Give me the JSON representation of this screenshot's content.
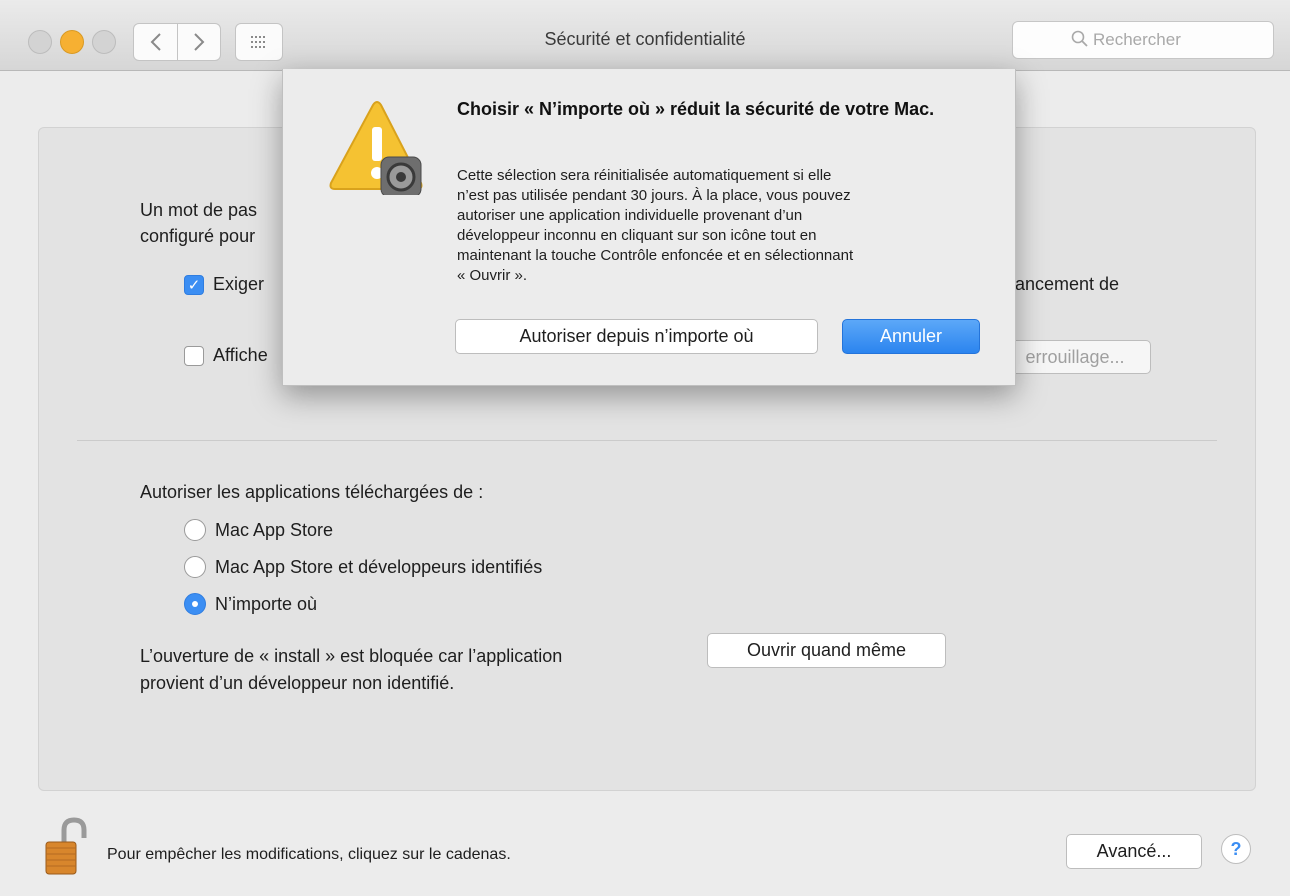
{
  "window": {
    "title": "Sécurité et confidentialité"
  },
  "toolbar": {
    "back_icon": "chevron-left-icon",
    "forward_icon": "chevron-right-icon",
    "grid_icon": "grid-icon",
    "search_placeholder": "Rechercher"
  },
  "general": {
    "password_line1": "Un mot de pas",
    "password_line2": "configuré pour",
    "require_label": "Exiger",
    "require_checked": true,
    "require_suffix": "lancement de",
    "show_label": "Affiche",
    "show_checked": false,
    "set_lock_button": "errouillage..."
  },
  "gatekeeper": {
    "heading": "Autoriser les applications téléchargées de :",
    "options": [
      {
        "label": "Mac App Store",
        "selected": false
      },
      {
        "label": "Mac App Store et développeurs identifiés",
        "selected": false
      },
      {
        "label": "N’importe où",
        "selected": true
      }
    ],
    "blocked_line1": "L’ouverture de « install » est bloquée car l’application",
    "blocked_line2": "provient d’un développeur non identifié.",
    "open_anyway_button": "Ouvrir quand même"
  },
  "footer": {
    "lock_text": "Pour empêcher les modifications, cliquez sur le cadenas.",
    "advanced_button": "Avancé...",
    "help_label": "?"
  },
  "dialog": {
    "title": "Choisir « N’importe où » réduit la sécurité de votre Mac.",
    "body_lines": [
      "Cette sélection sera réinitialisée automatiquement si elle",
      "n’est pas utilisée pendant 30 jours. À la place, vous pouvez",
      "autoriser une application individuelle provenant d’un",
      "développeur inconnu en cliquant sur son icône tout en",
      "maintenant la touche Contrôle enfoncée et en sélectionnant",
      "« Ouvrir »."
    ],
    "allow_button": "Autoriser depuis n’importe où",
    "cancel_button": "Annuler"
  },
  "colors": {
    "accent": "#3b8ef3",
    "warning": "#f5c232"
  }
}
